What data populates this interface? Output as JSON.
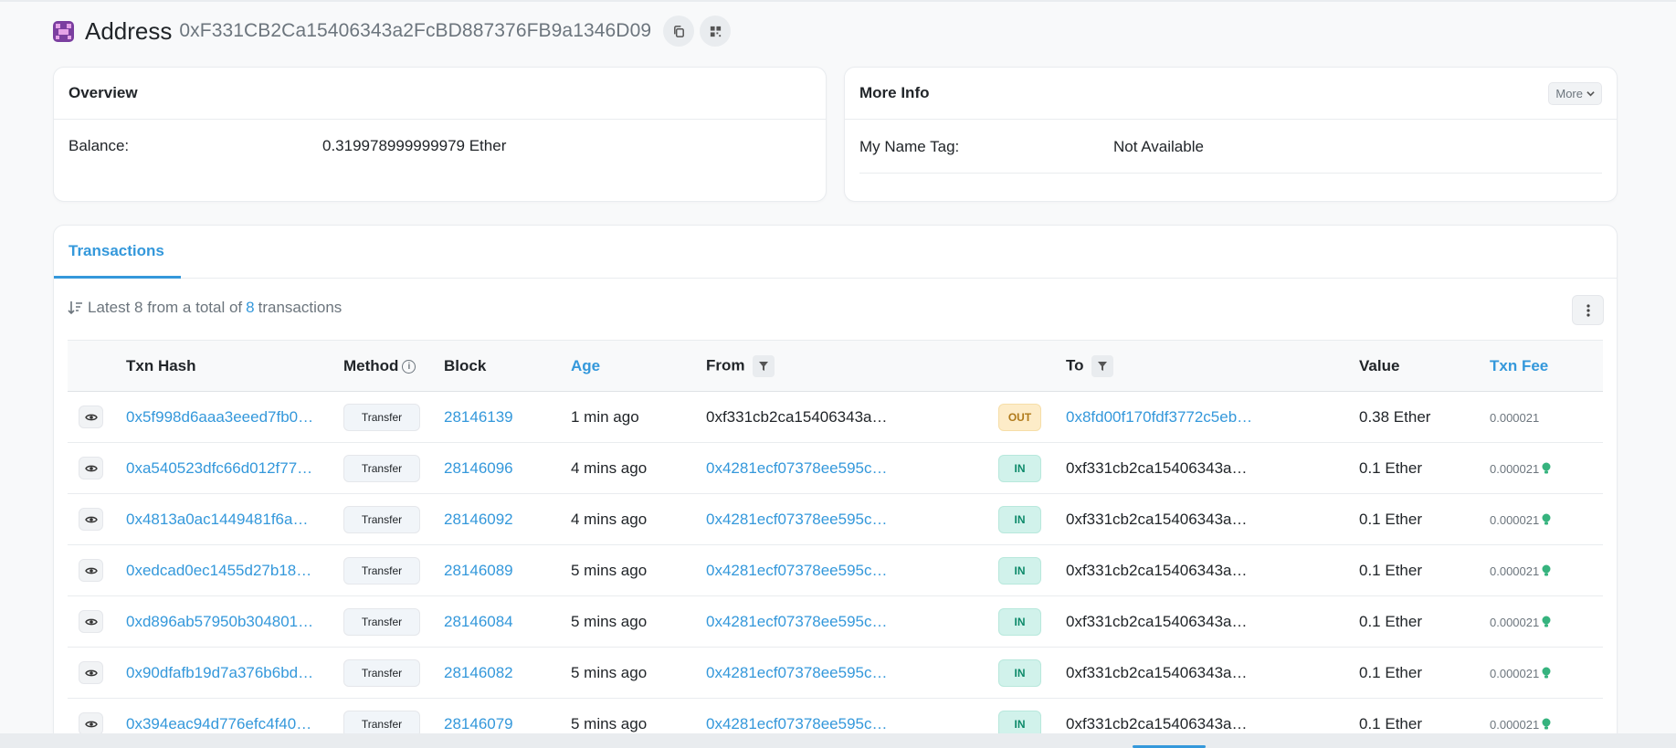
{
  "header": {
    "title": "Address",
    "address": "0xF331CB2Ca15406343a2FcBD887376FB9a1346D09"
  },
  "overview": {
    "title": "Overview",
    "balance_label": "Balance:",
    "balance_value": "0.319978999999979 Ether"
  },
  "more_info": {
    "title": "More Info",
    "more_label": "More",
    "name_tag_label": "My Name Tag:",
    "name_tag_value": "Not Available"
  },
  "transactions": {
    "tab_label": "Transactions",
    "summary_prefix": "Latest 8 from a total of",
    "summary_count": "8",
    "summary_suffix": "transactions",
    "columns": {
      "hash": "Txn Hash",
      "method": "Method",
      "block": "Block",
      "age": "Age",
      "from": "From",
      "to": "To",
      "value": "Value",
      "fee": "Txn Fee"
    },
    "rows": [
      {
        "hash": "0x5f998d6aaa3eeed7fb0…",
        "method": "Transfer",
        "block": "28146139",
        "age": "1 min ago",
        "from": "0xf331cb2ca15406343a…",
        "dir": "OUT",
        "to": "0x8fd00f170fdf3772c5eb…",
        "value": "0.38 Ether",
        "fee": "0.000021"
      },
      {
        "hash": "0xa540523dfc66d012f77…",
        "method": "Transfer",
        "block": "28146096",
        "age": "4 mins ago",
        "from": "0x4281ecf07378ee595c…",
        "dir": "IN",
        "to": "0xf331cb2ca15406343a…",
        "value": "0.1 Ether",
        "fee": "0.000021"
      },
      {
        "hash": "0x4813a0ac1449481f6a…",
        "method": "Transfer",
        "block": "28146092",
        "age": "4 mins ago",
        "from": "0x4281ecf07378ee595c…",
        "dir": "IN",
        "to": "0xf331cb2ca15406343a…",
        "value": "0.1 Ether",
        "fee": "0.000021"
      },
      {
        "hash": "0xedcad0ec1455d27b18…",
        "method": "Transfer",
        "block": "28146089",
        "age": "5 mins ago",
        "from": "0x4281ecf07378ee595c…",
        "dir": "IN",
        "to": "0xf331cb2ca15406343a…",
        "value": "0.1 Ether",
        "fee": "0.000021"
      },
      {
        "hash": "0xd896ab57950b304801…",
        "method": "Transfer",
        "block": "28146084",
        "age": "5 mins ago",
        "from": "0x4281ecf07378ee595c…",
        "dir": "IN",
        "to": "0xf331cb2ca15406343a…",
        "value": "0.1 Ether",
        "fee": "0.000021"
      },
      {
        "hash": "0x90dfafb19d7a376b6bd…",
        "method": "Transfer",
        "block": "28146082",
        "age": "5 mins ago",
        "from": "0x4281ecf07378ee595c…",
        "dir": "IN",
        "to": "0xf331cb2ca15406343a…",
        "value": "0.1 Ether",
        "fee": "0.000021"
      },
      {
        "hash": "0x394eac94d776efc4f40…",
        "method": "Transfer",
        "block": "28146079",
        "age": "5 mins ago",
        "from": "0x4281ecf07378ee595c…",
        "dir": "IN",
        "to": "0xf331cb2ca15406343a…",
        "value": "0.1 Ether",
        "fee": "0.000021"
      }
    ]
  },
  "colors": {
    "accent": "#3498db",
    "in_badge": "#d1f2eb",
    "out_badge": "#fdecc8"
  }
}
